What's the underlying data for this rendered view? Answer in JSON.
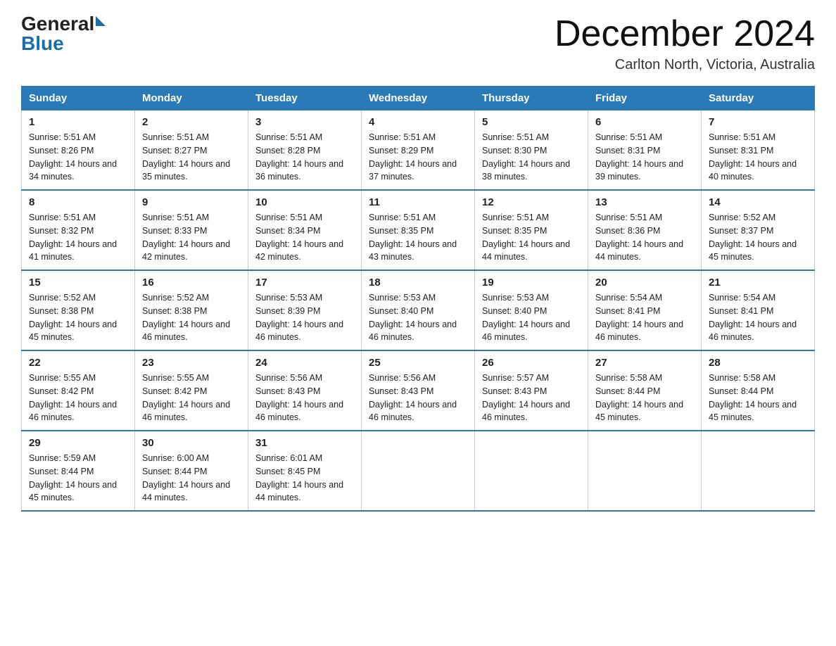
{
  "header": {
    "logo_general": "General",
    "logo_blue": "Blue",
    "title": "December 2024",
    "subtitle": "Carlton North, Victoria, Australia"
  },
  "days_of_week": [
    "Sunday",
    "Monday",
    "Tuesday",
    "Wednesday",
    "Thursday",
    "Friday",
    "Saturday"
  ],
  "weeks": [
    [
      {
        "day": "1",
        "sunrise": "Sunrise: 5:51 AM",
        "sunset": "Sunset: 8:26 PM",
        "daylight": "Daylight: 14 hours and 34 minutes."
      },
      {
        "day": "2",
        "sunrise": "Sunrise: 5:51 AM",
        "sunset": "Sunset: 8:27 PM",
        "daylight": "Daylight: 14 hours and 35 minutes."
      },
      {
        "day": "3",
        "sunrise": "Sunrise: 5:51 AM",
        "sunset": "Sunset: 8:28 PM",
        "daylight": "Daylight: 14 hours and 36 minutes."
      },
      {
        "day": "4",
        "sunrise": "Sunrise: 5:51 AM",
        "sunset": "Sunset: 8:29 PM",
        "daylight": "Daylight: 14 hours and 37 minutes."
      },
      {
        "day": "5",
        "sunrise": "Sunrise: 5:51 AM",
        "sunset": "Sunset: 8:30 PM",
        "daylight": "Daylight: 14 hours and 38 minutes."
      },
      {
        "day": "6",
        "sunrise": "Sunrise: 5:51 AM",
        "sunset": "Sunset: 8:31 PM",
        "daylight": "Daylight: 14 hours and 39 minutes."
      },
      {
        "day": "7",
        "sunrise": "Sunrise: 5:51 AM",
        "sunset": "Sunset: 8:31 PM",
        "daylight": "Daylight: 14 hours and 40 minutes."
      }
    ],
    [
      {
        "day": "8",
        "sunrise": "Sunrise: 5:51 AM",
        "sunset": "Sunset: 8:32 PM",
        "daylight": "Daylight: 14 hours and 41 minutes."
      },
      {
        "day": "9",
        "sunrise": "Sunrise: 5:51 AM",
        "sunset": "Sunset: 8:33 PM",
        "daylight": "Daylight: 14 hours and 42 minutes."
      },
      {
        "day": "10",
        "sunrise": "Sunrise: 5:51 AM",
        "sunset": "Sunset: 8:34 PM",
        "daylight": "Daylight: 14 hours and 42 minutes."
      },
      {
        "day": "11",
        "sunrise": "Sunrise: 5:51 AM",
        "sunset": "Sunset: 8:35 PM",
        "daylight": "Daylight: 14 hours and 43 minutes."
      },
      {
        "day": "12",
        "sunrise": "Sunrise: 5:51 AM",
        "sunset": "Sunset: 8:35 PM",
        "daylight": "Daylight: 14 hours and 44 minutes."
      },
      {
        "day": "13",
        "sunrise": "Sunrise: 5:51 AM",
        "sunset": "Sunset: 8:36 PM",
        "daylight": "Daylight: 14 hours and 44 minutes."
      },
      {
        "day": "14",
        "sunrise": "Sunrise: 5:52 AM",
        "sunset": "Sunset: 8:37 PM",
        "daylight": "Daylight: 14 hours and 45 minutes."
      }
    ],
    [
      {
        "day": "15",
        "sunrise": "Sunrise: 5:52 AM",
        "sunset": "Sunset: 8:38 PM",
        "daylight": "Daylight: 14 hours and 45 minutes."
      },
      {
        "day": "16",
        "sunrise": "Sunrise: 5:52 AM",
        "sunset": "Sunset: 8:38 PM",
        "daylight": "Daylight: 14 hours and 46 minutes."
      },
      {
        "day": "17",
        "sunrise": "Sunrise: 5:53 AM",
        "sunset": "Sunset: 8:39 PM",
        "daylight": "Daylight: 14 hours and 46 minutes."
      },
      {
        "day": "18",
        "sunrise": "Sunrise: 5:53 AM",
        "sunset": "Sunset: 8:40 PM",
        "daylight": "Daylight: 14 hours and 46 minutes."
      },
      {
        "day": "19",
        "sunrise": "Sunrise: 5:53 AM",
        "sunset": "Sunset: 8:40 PM",
        "daylight": "Daylight: 14 hours and 46 minutes."
      },
      {
        "day": "20",
        "sunrise": "Sunrise: 5:54 AM",
        "sunset": "Sunset: 8:41 PM",
        "daylight": "Daylight: 14 hours and 46 minutes."
      },
      {
        "day": "21",
        "sunrise": "Sunrise: 5:54 AM",
        "sunset": "Sunset: 8:41 PM",
        "daylight": "Daylight: 14 hours and 46 minutes."
      }
    ],
    [
      {
        "day": "22",
        "sunrise": "Sunrise: 5:55 AM",
        "sunset": "Sunset: 8:42 PM",
        "daylight": "Daylight: 14 hours and 46 minutes."
      },
      {
        "day": "23",
        "sunrise": "Sunrise: 5:55 AM",
        "sunset": "Sunset: 8:42 PM",
        "daylight": "Daylight: 14 hours and 46 minutes."
      },
      {
        "day": "24",
        "sunrise": "Sunrise: 5:56 AM",
        "sunset": "Sunset: 8:43 PM",
        "daylight": "Daylight: 14 hours and 46 minutes."
      },
      {
        "day": "25",
        "sunrise": "Sunrise: 5:56 AM",
        "sunset": "Sunset: 8:43 PM",
        "daylight": "Daylight: 14 hours and 46 minutes."
      },
      {
        "day": "26",
        "sunrise": "Sunrise: 5:57 AM",
        "sunset": "Sunset: 8:43 PM",
        "daylight": "Daylight: 14 hours and 46 minutes."
      },
      {
        "day": "27",
        "sunrise": "Sunrise: 5:58 AM",
        "sunset": "Sunset: 8:44 PM",
        "daylight": "Daylight: 14 hours and 45 minutes."
      },
      {
        "day": "28",
        "sunrise": "Sunrise: 5:58 AM",
        "sunset": "Sunset: 8:44 PM",
        "daylight": "Daylight: 14 hours and 45 minutes."
      }
    ],
    [
      {
        "day": "29",
        "sunrise": "Sunrise: 5:59 AM",
        "sunset": "Sunset: 8:44 PM",
        "daylight": "Daylight: 14 hours and 45 minutes."
      },
      {
        "day": "30",
        "sunrise": "Sunrise: 6:00 AM",
        "sunset": "Sunset: 8:44 PM",
        "daylight": "Daylight: 14 hours and 44 minutes."
      },
      {
        "day": "31",
        "sunrise": "Sunrise: 6:01 AM",
        "sunset": "Sunset: 8:45 PM",
        "daylight": "Daylight: 14 hours and 44 minutes."
      },
      null,
      null,
      null,
      null
    ]
  ]
}
